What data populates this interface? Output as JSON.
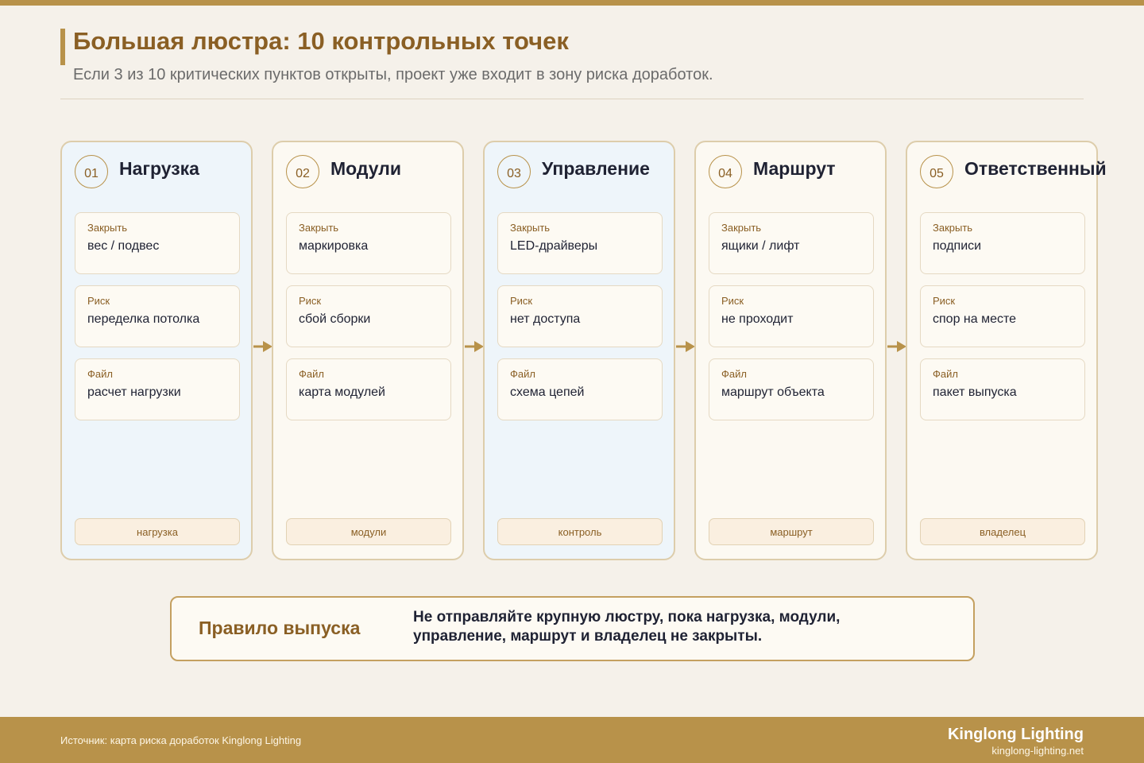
{
  "header": {
    "title": "Большая люстра: 10 контрольных точек",
    "subtitle": "Если 3 из 10 критических пунктов открыты, проект уже входит в зону риска доработок."
  },
  "colors": {
    "accent": "#b8924a",
    "accent_dark": "#8a5f24",
    "background": "#f5f1ea",
    "column_blue": "#eef5fa",
    "column_cream": "#fcf9f2"
  },
  "columns": [
    {
      "number": "01",
      "title": "Нагрузка",
      "cards": [
        {
          "label": "Закрыть",
          "value": "вес / подвес"
        },
        {
          "label": "Риск",
          "value": "переделка потолка"
        },
        {
          "label": "Файл",
          "value": "расчет нагрузки"
        }
      ],
      "tag": "нагрузка"
    },
    {
      "number": "02",
      "title": "Модули",
      "cards": [
        {
          "label": "Закрыть",
          "value": "маркировка"
        },
        {
          "label": "Риск",
          "value": "сбой сборки"
        },
        {
          "label": "Файл",
          "value": "карта модулей"
        }
      ],
      "tag": "модули"
    },
    {
      "number": "03",
      "title": "Управление",
      "cards": [
        {
          "label": "Закрыть",
          "value": "LED-драйверы"
        },
        {
          "label": "Риск",
          "value": "нет доступа"
        },
        {
          "label": "Файл",
          "value": "схема цепей"
        }
      ],
      "tag": "контроль"
    },
    {
      "number": "04",
      "title": "Маршрут",
      "cards": [
        {
          "label": "Закрыть",
          "value": "ящики / лифт"
        },
        {
          "label": "Риск",
          "value": "не проходит"
        },
        {
          "label": "Файл",
          "value": "маршрут объекта"
        }
      ],
      "tag": "маршрут"
    },
    {
      "number": "05",
      "title": "Ответственный",
      "cards": [
        {
          "label": "Закрыть",
          "value": "подписи"
        },
        {
          "label": "Риск",
          "value": "спор на месте"
        },
        {
          "label": "Файл",
          "value": "пакет выпуска"
        }
      ],
      "tag": "владелец"
    }
  ],
  "rule": {
    "title": "Правило выпуска",
    "text": "Не отправляйте крупную люстру, пока нагрузка, модули, управление, маршрут и владелец не закрыты."
  },
  "footer": {
    "source": "Источник: карта риска доработок Kinglong Lighting",
    "brand": "Kinglong Lighting",
    "url": "kinglong-lighting.net"
  }
}
